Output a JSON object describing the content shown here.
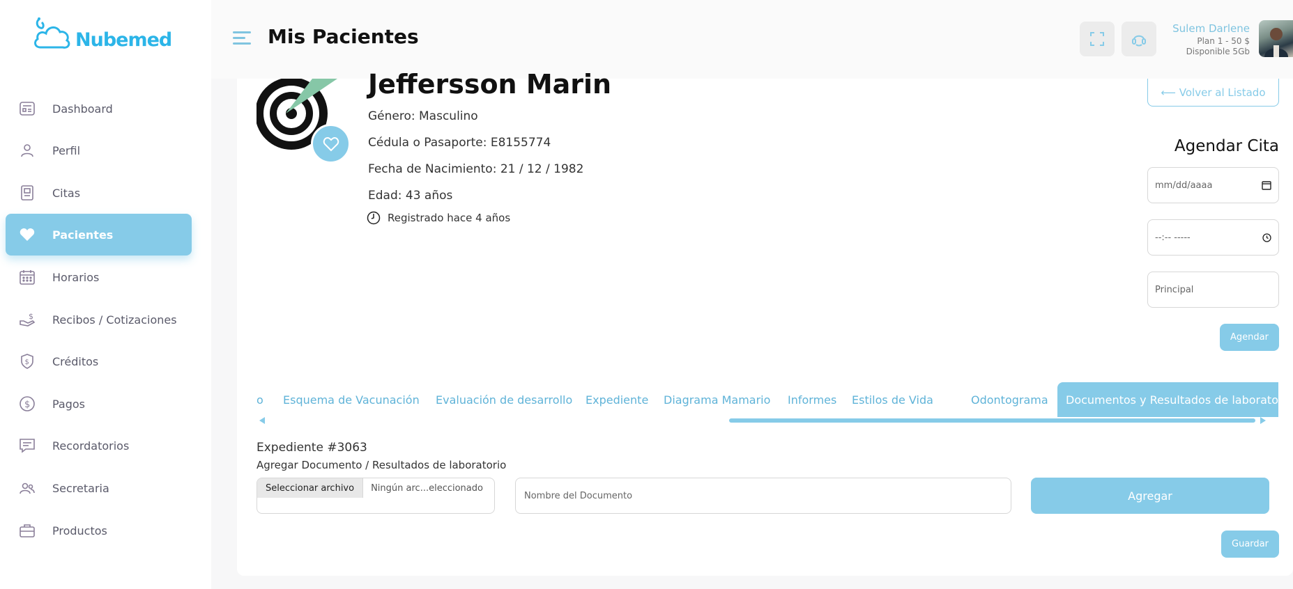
{
  "brand": {
    "name": "Nubemed",
    "color": "#2cb5e8",
    "accent": "#86cbe8"
  },
  "sidebar": {
    "items": [
      {
        "label": "Dashboard",
        "icon": "dashboard-icon"
      },
      {
        "label": "Perfil",
        "icon": "user-icon"
      },
      {
        "label": "Citas",
        "icon": "clipboard-icon"
      },
      {
        "label": "Pacientes",
        "icon": "heart-icon",
        "active": true
      },
      {
        "label": "Horarios",
        "icon": "calendar-icon"
      },
      {
        "label": "Recibos / Cotizaciones",
        "icon": "hand-money-icon"
      },
      {
        "label": "Créditos",
        "icon": "shield-dollar-icon"
      },
      {
        "label": "Pagos",
        "icon": "dollar-circle-icon"
      },
      {
        "label": "Recordatorios",
        "icon": "message-icon"
      },
      {
        "label": "Secretaria",
        "icon": "users-icon"
      },
      {
        "label": "Productos",
        "icon": "briefcase-icon"
      }
    ]
  },
  "header": {
    "title": "Mis Pacientes",
    "user_name": "Sulem Darlene",
    "user_plan": "Plan 1 - 50 $",
    "user_storage": "Disponible 5Gb"
  },
  "patient": {
    "name": "Jeffersson Marin",
    "gender": "Género: Masculino",
    "id_doc": "Cédula o Pasaporte: E8155774",
    "birth": "Fecha de Nacimiento: 21 / 12 / 1982",
    "age": "Edad: 43 años",
    "registered": "Registrado hace 4 años"
  },
  "appointment": {
    "back_label": "⟵ Volver al Listado",
    "title": "Agendar Cita",
    "date_placeholder": "mm/dd/aaaa",
    "time_placeholder": "--:-- -----",
    "location_value": "Principal",
    "submit_label": "Agendar"
  },
  "tabs": [
    {
      "label": "o"
    },
    {
      "label": "Esquema de Vacunación"
    },
    {
      "label": "Evaluación de desarrollo"
    },
    {
      "label": "Expediente"
    },
    {
      "label": "Diagrama Mamario"
    },
    {
      "label": "Informes"
    },
    {
      "label": "Estilos de Vida"
    },
    {
      "label": "Odontograma"
    },
    {
      "label": "Documentos y Resultados de laboratorio",
      "active": true
    }
  ],
  "documents": {
    "record_title": "Expediente #3063",
    "section_title": "Agregar Documento / Resultados de laboratorio",
    "file_button": "Seleccionar archivo",
    "file_status": "Ningún arc...eleccionado",
    "doc_name_placeholder": "Nombre del Documento",
    "add_label": "Agregar",
    "save_label": "Guardar"
  }
}
